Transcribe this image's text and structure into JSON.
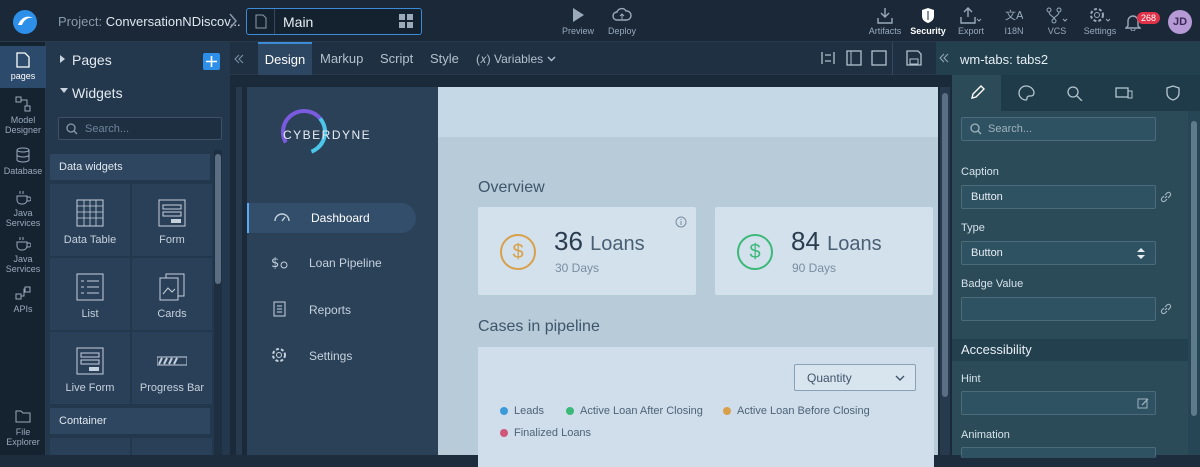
{
  "project": {
    "label": "Project:",
    "name": "ConversationNDiscov..."
  },
  "page": {
    "name": "Main"
  },
  "toolbar": {
    "preview": "Preview",
    "deploy": "Deploy",
    "artifacts": "Artifacts",
    "security": "Security",
    "export": "Export",
    "i18n": "I18N",
    "vcs": "VCS",
    "settings": "Settings",
    "notif_count": "268",
    "avatar": "JD"
  },
  "leftnav": [
    "pages",
    "Model Designer",
    "Database",
    "Java Services",
    "Java Services",
    "APIs",
    "File Explorer"
  ],
  "panel": {
    "pages": "Pages",
    "widgets": "Widgets",
    "search_placeholder": "Search...",
    "cat_data": "Data widgets",
    "cat_container": "Container",
    "tiles": [
      "Data Table",
      "Form",
      "List",
      "Cards",
      "Live Form",
      "Progress Bar"
    ]
  },
  "tabs": {
    "design": "Design",
    "markup": "Markup",
    "script": "Script",
    "style": "Style",
    "variables": "(𝑥) Variables"
  },
  "app": {
    "brand": "CYBERDYNE",
    "nav": [
      "Dashboard",
      "Loan Pipeline",
      "Reports",
      "Settings"
    ],
    "overview": "Overview",
    "cases": "Cases in pipeline",
    "card1": {
      "num": "36",
      "unit": "Loans",
      "sub": "30 Days"
    },
    "card2": {
      "num": "84",
      "unit": "Loans",
      "sub": "90 Days"
    },
    "select": "Quantity",
    "legend": [
      "Leads",
      "Active Loan After Closing",
      "Active Loan Before Closing",
      "Finalized Loans"
    ],
    "colors": {
      "leads": "#3b9ad9",
      "after": "#3cb878",
      "before": "#d8a04a",
      "final": "#d1577a"
    }
  },
  "props": {
    "title": "wm-tabs: tabs2",
    "search_placeholder": "Search...",
    "caption_label": "Caption",
    "caption_value": "Button",
    "type_label": "Type",
    "type_value": "Button",
    "badge_label": "Badge Value",
    "accessibility": "Accessibility",
    "hint_label": "Hint",
    "animation_label": "Animation"
  }
}
